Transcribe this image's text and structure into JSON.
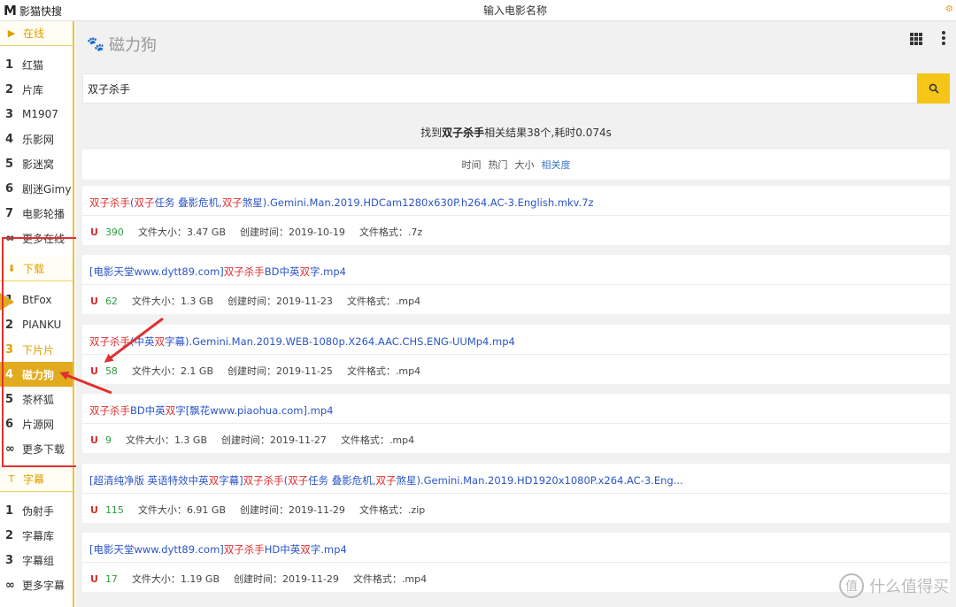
{
  "app": {
    "logo": "M",
    "name": "影猫快搜",
    "top_title": "输入电影名称"
  },
  "sidebar": {
    "sections": [
      {
        "title": "在线",
        "icon": "play-icon",
        "items": [
          {
            "num": "1",
            "label": "红猫"
          },
          {
            "num": "2",
            "label": "片库"
          },
          {
            "num": "3",
            "label": "M1907"
          },
          {
            "num": "4",
            "label": "乐影网"
          },
          {
            "num": "5",
            "label": "影迷窝"
          },
          {
            "num": "6",
            "label": "剧迷Gimy"
          },
          {
            "num": "7",
            "label": "电影轮播"
          },
          {
            "num": "∞",
            "label": "更多在线"
          }
        ]
      },
      {
        "title": "下载",
        "icon": "download-icon",
        "items": [
          {
            "num": "1",
            "label": "BtFox"
          },
          {
            "num": "2",
            "label": "PIANKU"
          },
          {
            "num": "3",
            "label": "下片片"
          },
          {
            "num": "4",
            "label": "磁力狗"
          },
          {
            "num": "5",
            "label": "茶杯狐"
          },
          {
            "num": "6",
            "label": "片源网"
          },
          {
            "num": "∞",
            "label": "更多下载"
          }
        ]
      },
      {
        "title": "字幕",
        "icon": "subtitle-icon",
        "items": [
          {
            "num": "1",
            "label": "伪射手"
          },
          {
            "num": "2",
            "label": "字幕库"
          },
          {
            "num": "3",
            "label": "字幕组"
          },
          {
            "num": "∞",
            "label": "更多字幕"
          }
        ]
      }
    ]
  },
  "main": {
    "site_name": "磁力狗",
    "search": {
      "value": "双子杀手"
    },
    "summary": {
      "prefix": "找到",
      "keyword": "双子杀手",
      "suffix": "相关结果38个,耗时0.074s"
    },
    "sort": {
      "options": [
        "时间",
        "热门",
        "大小",
        "相关度"
      ],
      "selected": "相关度"
    },
    "labels": {
      "size": "文件大小：",
      "created": "创建时间：",
      "format": "文件格式："
    },
    "results": [
      {
        "title_parts": [
          [
            "双子杀手",
            "hl"
          ],
          [
            "(",
            ""
          ],
          [
            "双子",
            "hl"
          ],
          [
            "任务 叠影危机,",
            ""
          ],
          [
            "双子",
            "hl"
          ],
          [
            "煞星).Gemini.Man.2019.HDCam1280x630P.h264.AC-3.English.mkv.7z",
            ""
          ]
        ],
        "seeds": "390",
        "size": "3.47 GB",
        "created": "2019-10-19",
        "format": ".7z"
      },
      {
        "title_parts": [
          [
            "[电影天堂www.dytt89.com]",
            ""
          ],
          [
            "双子杀手",
            "hl"
          ],
          [
            "BD中英",
            ""
          ],
          [
            "双",
            "hl"
          ],
          [
            "字.mp4",
            ""
          ]
        ],
        "seeds": "62",
        "size": "1.3 GB",
        "created": "2019-11-23",
        "format": ".mp4"
      },
      {
        "title_parts": [
          [
            "双子杀手",
            "hl"
          ],
          [
            "(中英",
            ""
          ],
          [
            "双",
            "hl"
          ],
          [
            "字幕).Gemini.Man.2019.WEB-1080p.X264.AAC.CHS.ENG-UUMp4.mp4",
            ""
          ]
        ],
        "seeds": "58",
        "size": "2.1 GB",
        "created": "2019-11-25",
        "format": ".mp4"
      },
      {
        "title_parts": [
          [
            "双子杀手",
            "hl"
          ],
          [
            "BD中英",
            ""
          ],
          [
            "双",
            "hl"
          ],
          [
            "字[飘花www.piaohua.com].mp4",
            ""
          ]
        ],
        "seeds": "9",
        "size": "1.3 GB",
        "created": "2019-11-27",
        "format": ".mp4"
      },
      {
        "title_parts": [
          [
            "[超清纯净版 英语特效中英",
            ""
          ],
          [
            "双",
            "hl"
          ],
          [
            "字幕]",
            ""
          ],
          [
            "双子杀手",
            "hl"
          ],
          [
            "(",
            ""
          ],
          [
            "双子",
            "hl"
          ],
          [
            "任务 叠影危机,",
            ""
          ],
          [
            "双子",
            "hl"
          ],
          [
            "煞星).Gemini.Man.2019.HD1920x1080P.x264.AC-3.Eng...",
            ""
          ]
        ],
        "seeds": "115",
        "size": "6.91 GB",
        "created": "2019-11-29",
        "format": ".zip"
      },
      {
        "title_parts": [
          [
            "[电影天堂www.dytt89.com]",
            ""
          ],
          [
            "双子杀手",
            "hl"
          ],
          [
            "HD中英",
            ""
          ],
          [
            "双",
            "hl"
          ],
          [
            "字.mp4",
            ""
          ]
        ],
        "seeds": "17",
        "size": "1.19 GB",
        "created": "2019-11-29",
        "format": ".mp4"
      }
    ]
  },
  "watermark": "什么值得买",
  "colors": {
    "accent": "#e2aa1e",
    "highlight": "#e03030",
    "link": "#2c55c8",
    "seeds": "#2e9c44",
    "search_button": "#f5c518"
  }
}
